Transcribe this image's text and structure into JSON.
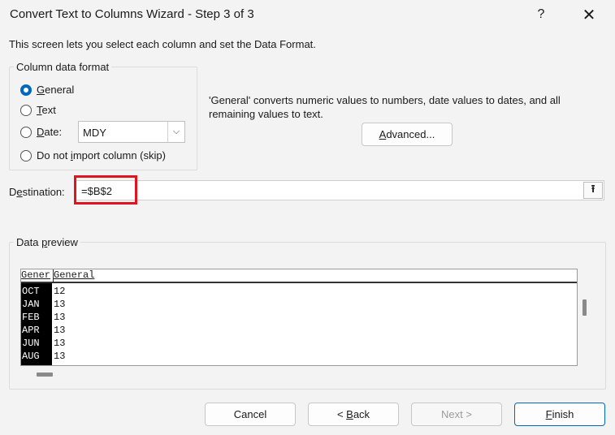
{
  "window": {
    "title": "Convert Text to Columns Wizard - Step 3 of 3",
    "help_label": "?",
    "close_label": "✕"
  },
  "intro": "This screen lets you select each column and set the Data Format.",
  "format_group": {
    "legend": "Column data format",
    "options": [
      {
        "label_pre": "",
        "label_key": "G",
        "label_post": "eneral",
        "checked": true
      },
      {
        "label_pre": "",
        "label_key": "T",
        "label_post": "ext",
        "checked": false
      },
      {
        "label_pre": "",
        "label_key": "D",
        "label_post": "ate:",
        "checked": false
      },
      {
        "label_pre": "Do not ",
        "label_key": "i",
        "label_post": "mport column (skip)",
        "checked": false
      }
    ],
    "date_format": {
      "value": "MDY",
      "arrow": "⌵"
    }
  },
  "description": "'General' converts numeric values to numbers, date values to dates, and all remaining values to text.",
  "advanced_button": {
    "label_key": "A",
    "label_post": "dvanced..."
  },
  "destination": {
    "label_pre": "D",
    "label_key": "e",
    "label_post": "stination:",
    "value": "=$B$2",
    "collapse_icon": "⭱"
  },
  "preview": {
    "legend_pre": "Data ",
    "legend_key": "p",
    "legend_post": "review",
    "headers": [
      "Gener",
      "General"
    ],
    "rows": [
      [
        "OCT",
        "12"
      ],
      [
        "JAN",
        "13"
      ],
      [
        "FEB",
        "13"
      ],
      [
        "APR",
        "13"
      ],
      [
        "JUN",
        "13"
      ],
      [
        "AUG",
        "13"
      ]
    ]
  },
  "buttons": {
    "cancel": "Cancel",
    "back_pre": "< ",
    "back_key": "B",
    "back_post": "ack",
    "next": "Next >",
    "finish_key": "F",
    "finish_post": "inish"
  },
  "colors": {
    "accent": "#0067c0",
    "highlight": "#e0141e"
  }
}
